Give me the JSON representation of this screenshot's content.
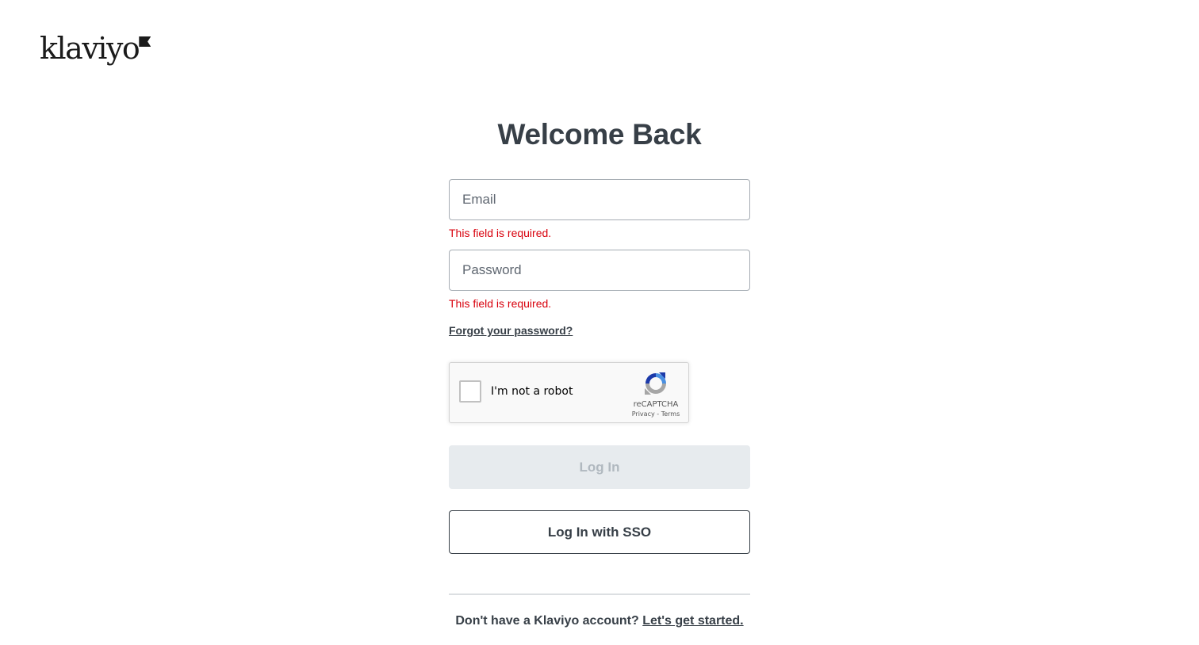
{
  "header": {
    "logo_text": "klaviyo"
  },
  "login": {
    "title": "Welcome Back",
    "email": {
      "placeholder": "Email",
      "value": "",
      "error": "This field is required."
    },
    "password": {
      "placeholder": "Password",
      "value": "",
      "error": "This field is required."
    },
    "forgot_link": "Forgot your password?",
    "recaptcha": {
      "label": "I'm not a robot",
      "brand": "reCAPTCHA",
      "privacy": "Privacy",
      "separator": " - ",
      "terms": "Terms",
      "checked": false
    },
    "login_button": "Log In",
    "sso_button": "Log In with SSO",
    "signup_prompt": "Don't have a Klaviyo account?",
    "signup_link": "Let's get started."
  },
  "colors": {
    "text": "#373f47",
    "error": "#d8000c",
    "disabled_button_bg": "#e7ebee",
    "disabled_button_text": "#b0b8bf",
    "recaptcha_blue": "#4a90e2",
    "recaptcha_dark_blue": "#1c3aa9",
    "recaptcha_gray": "#a6a6a6"
  }
}
